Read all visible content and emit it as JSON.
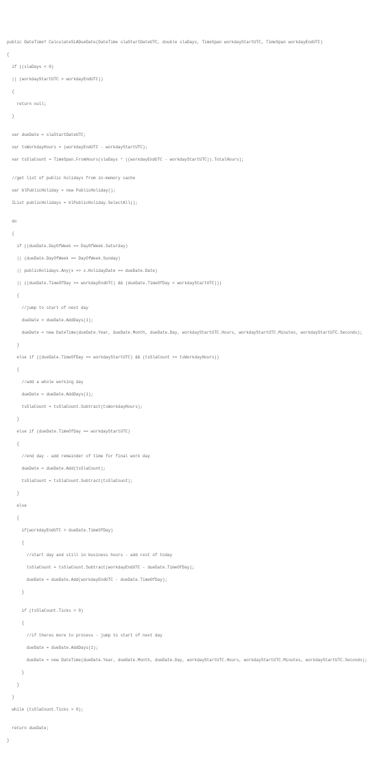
{
  "code": {
    "line1": "public DateTime? CalculateSLADueDate(DateTime slaStartDateUTC, double slaDays, TimeSpan workdayStartUTC, TimeSpan workdayEndUTC)",
    "line2": "{",
    "line3": "  if ((slaDays < 0)",
    "line4": "  || (workdayStartUTC > workdayEndUTC))",
    "line5": "  {",
    "line6": "    return null;",
    "line7": "  }",
    "line8": "",
    "line9": "  var dueDate = slaStartDateUTC;",
    "line10": "  var tsWorkdayHours = (workdayEndUTC - workdayStartUTC);",
    "line11": "  var tsSlaCount = TimeSpan.FromHours(slaDays * ((workdayEndUTC - workdayStartUTC)).TotalHours);",
    "line12": "",
    "line13": "  //get list of public holidays from in-memory cache",
    "line14": "  var blPublicHoliday = new PublicHoliday();",
    "line15": "  IList publicHolidays = blPublicHoliday.SelectAll();",
    "line16": "",
    "line17": "  do",
    "line18": "  {",
    "line19": "    if ((dueDate.DayOfWeek == DayOfWeek.Saturday)",
    "line20": "    || (dueDate.DayOfWeek == DayOfWeek.Sunday)",
    "line21": "    || publicHolidays.Any(x => x.HolidayDate == dueDate.Date)",
    "line22": "    || ((dueDate.TimeOfDay >= workdayEndUTC) && (dueDate.TimeOfDay < workdayStartUTC)))",
    "line23": "    {",
    "line24": "      //jump to start of next day",
    "line25": "      dueDate = dueDate.AddDays(1);",
    "line26": "      dueDate = new DateTime(dueDate.Year, dueDate.Month, dueDate.Day, workdayStartUTC.Hours, workdayStartUTC.Minutes, workdayStartUTC.Seconds);",
    "line27": "    }",
    "line28": "    else if ((dueDate.TimeOfDay == workdayStartUTC) && (tsSlaCount >= tsWorkdayHours))",
    "line29": "    {",
    "line30": "      //add a whole working day",
    "line31": "      dueDate = dueDate.AddDays(1);",
    "line32": "      tsSlaCount = tsSlaCount.Subtract(tsWorkdayHours);",
    "line33": "    }",
    "line34": "    else if (dueDate.TimeOfDay == workdayStartUTC)",
    "line35": "    {",
    "line36": "      //end day - add remainder of time for final work day",
    "line37": "      dueDate = dueDate.Add(tsSlaCount);",
    "line38": "      tsSlaCount = tsSlaCount.Subtract(tsSlaCount);",
    "line39": "    }",
    "line40": "    else",
    "line41": "    {",
    "line42": "      if(workdayEndUTC > dueDate.TimeOfDay)",
    "line43": "      {",
    "line44": "        //start day and still in business hours - add rest of today",
    "line45": "        tsSlaCount = tsSlaCount.Subtract(workdayEndUTC - dueDate.TimeOfDay);",
    "line46": "        dueDate = dueDate.Add(workdayEndUTC - dueDate.TimeOfDay);",
    "line47": "      }",
    "line48": "",
    "line49": "      if (tsSlaCount.Ticks > 0)",
    "line50": "      {",
    "line51": "        //if theres more to process - jump to start of next day",
    "line52": "        dueDate = dueDate.AddDays(1);",
    "line53": "        dueDate = new DateTime(dueDate.Year, dueDate.Month, dueDate.Day, workdayStartUTC.Hours, workdayStartUTC.Minutes, workdayStartUTC.Seconds);",
    "line54": "      }",
    "line55": "    }",
    "line56": "  }",
    "line57": "  while (tsSlaCount.Ticks > 0);",
    "line58": "",
    "line59": "  return dueDate;",
    "line60": "}"
  }
}
